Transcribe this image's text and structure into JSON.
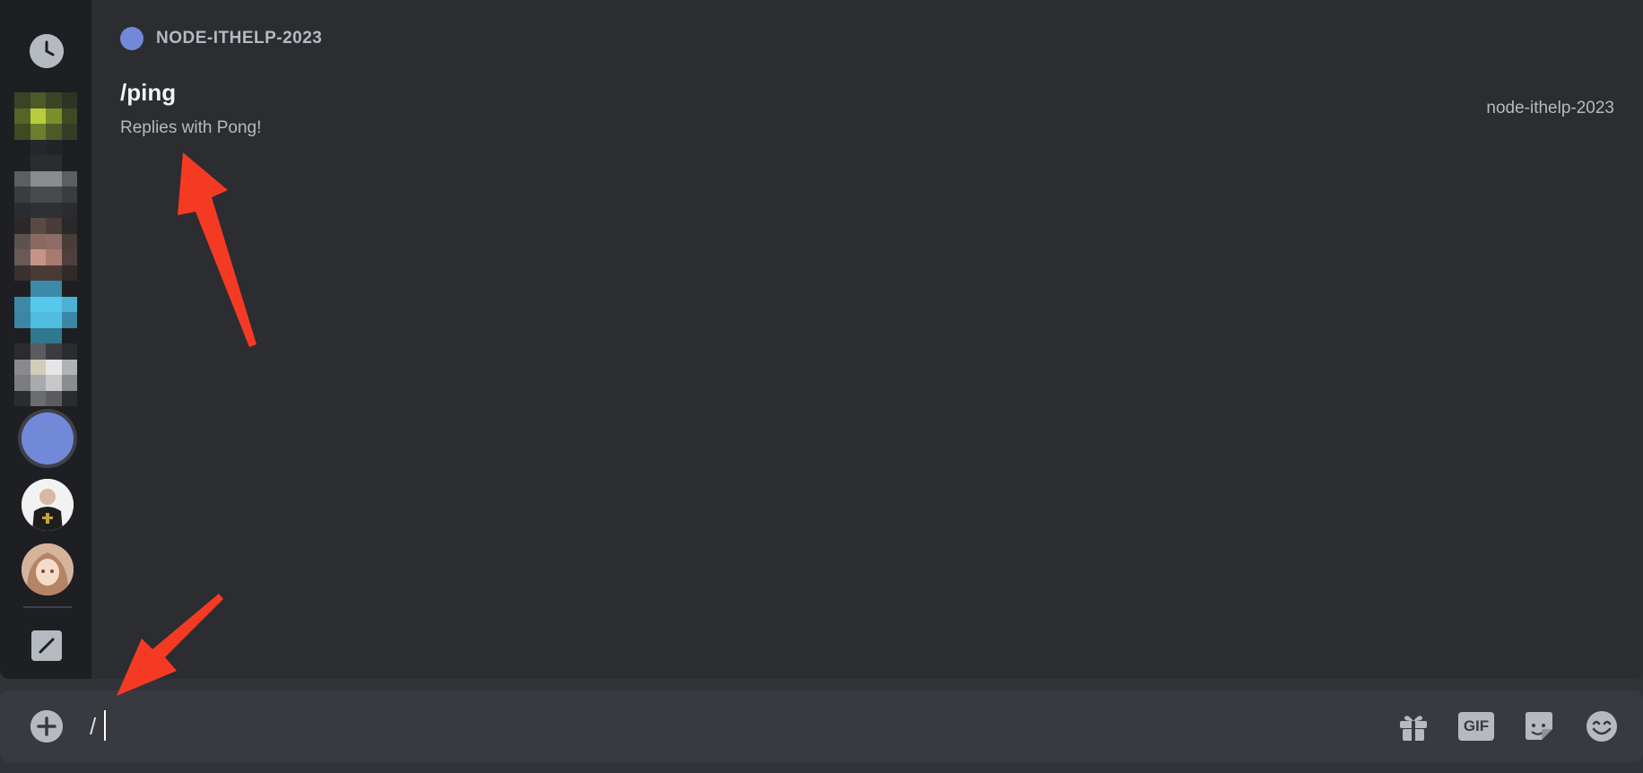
{
  "popup": {
    "section": {
      "title": "NODE-ITHELP-2023",
      "icon": "server-dot-icon",
      "color": "#7289da"
    },
    "commands": [
      {
        "name": "/ping",
        "description": "Replies with Pong!",
        "source": "node-ithelp-2023"
      }
    ]
  },
  "rail": {
    "items": [
      {
        "icon": "clock-icon"
      },
      {
        "icon": "server-avatar-1"
      },
      {
        "icon": "server-avatar-2"
      },
      {
        "icon": "server-avatar-3"
      },
      {
        "icon": "server-avatar-4"
      },
      {
        "icon": "server-avatar-5"
      },
      {
        "icon": "server-avatar-selected",
        "color": "#7289da"
      },
      {
        "icon": "user-avatar-priest"
      },
      {
        "icon": "user-avatar-anime"
      },
      {
        "icon": "pen-icon"
      }
    ]
  },
  "composer": {
    "value": "/",
    "tools": [
      "add-icon",
      "gift-icon",
      "gif-button",
      "sticker-icon",
      "emoji-icon"
    ],
    "gif_label": "GIF"
  },
  "annotations": {
    "arrow_color": "#f53a24"
  }
}
